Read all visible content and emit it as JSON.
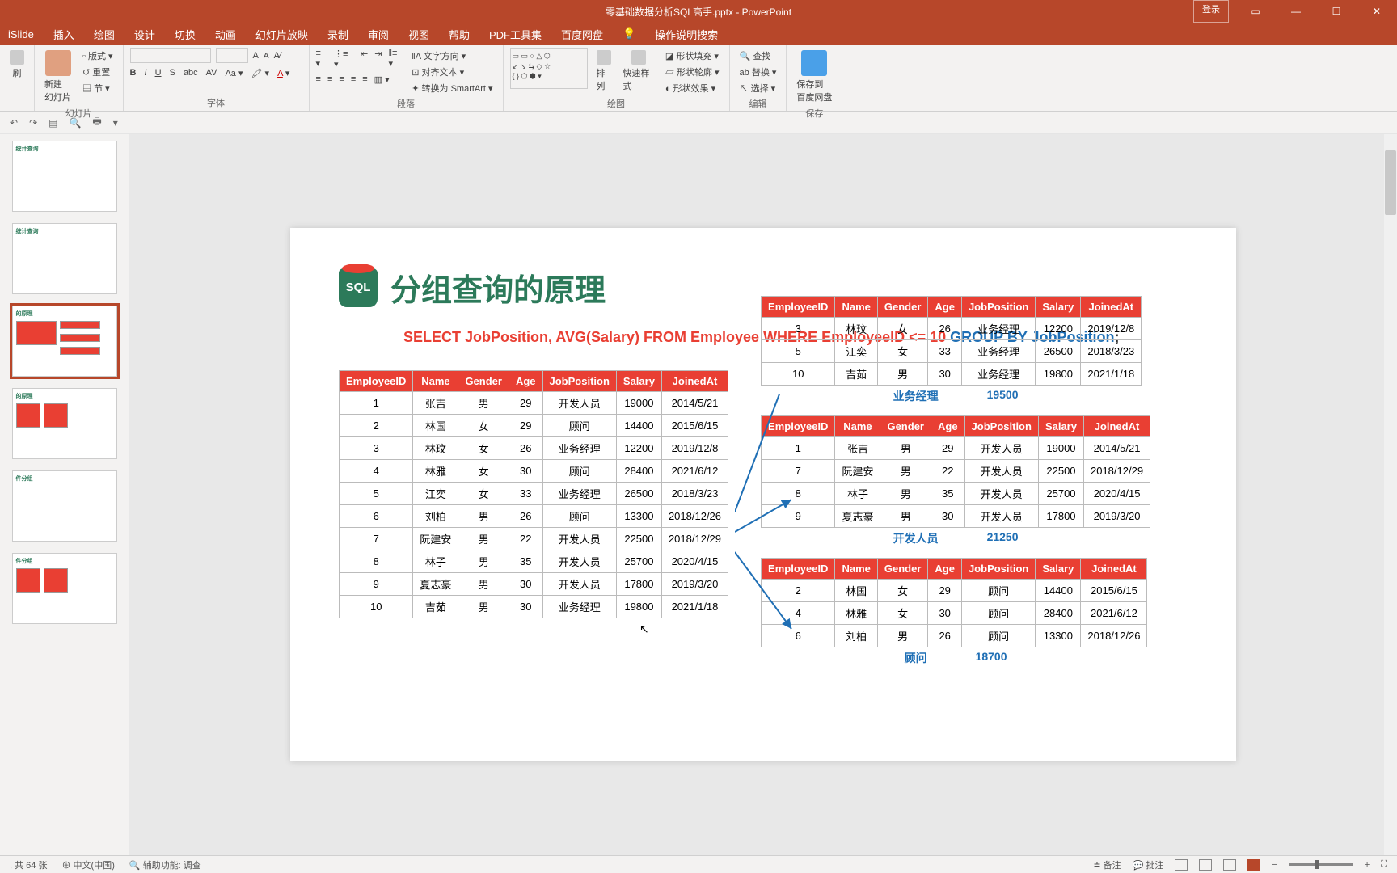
{
  "title_bar": {
    "filename": "零基础数据分析SQL高手.pptx  -  PowerPoint",
    "login": "登录"
  },
  "menu": [
    "iSlide",
    "插入",
    "绘图",
    "设计",
    "切换",
    "动画",
    "幻灯片放映",
    "录制",
    "审阅",
    "视图",
    "帮助",
    "PDF工具集",
    "百度网盘"
  ],
  "tell_me_icon": "💡",
  "tell_me": "操作说明搜索",
  "ribbon": {
    "g1_label": "幻灯片",
    "g1_new": "新建\n幻灯片",
    "g1_layout": "版式",
    "g1_reset": "重置",
    "g1_section": "节",
    "g2_label": "字体",
    "g3_label": "段落",
    "g3_dir": "文字方向",
    "g3_align": "对齐文本",
    "g3_smart": "转换为 SmartArt",
    "g4_label": "绘图",
    "g4_arrange": "排列",
    "g4_quick": "快速样式",
    "g4_fill": "形状填充",
    "g4_outline": "形状轮廓",
    "g4_fx": "形状效果",
    "g5_label": "编辑",
    "g5_find": "查找",
    "g5_replace": "替换",
    "g5_select": "选择",
    "g6_label": "保存",
    "g6_save": "保存到\n百度网盘"
  },
  "slide": {
    "title": "分组查询的原理",
    "sql_icon": "SQL",
    "query_red": "SELECT JobPosition, AVG(Salary) FROM Employee WHERE EmployeeID <= 10 ",
    "query_blue": "GROUP BY JobPosition",
    "query_end": ";",
    "headers": [
      "EmployeeID",
      "Name",
      "Gender",
      "Age",
      "JobPosition",
      "Salary",
      "JoinedAt"
    ],
    "main_rows": [
      [
        "1",
        "张吉",
        "男",
        "29",
        "开发人员",
        "19000",
        "2014/5/21"
      ],
      [
        "2",
        "林国",
        "女",
        "29",
        "顾问",
        "14400",
        "2015/6/15"
      ],
      [
        "3",
        "林玟",
        "女",
        "26",
        "业务经理",
        "12200",
        "2019/12/8"
      ],
      [
        "4",
        "林雅",
        "女",
        "30",
        "顾问",
        "28400",
        "2021/6/12"
      ],
      [
        "5",
        "江奕",
        "女",
        "33",
        "业务经理",
        "26500",
        "2018/3/23"
      ],
      [
        "6",
        "刘柏",
        "男",
        "26",
        "顾问",
        "13300",
        "2018/12/26"
      ],
      [
        "7",
        "阮建安",
        "男",
        "22",
        "开发人员",
        "22500",
        "2018/12/29"
      ],
      [
        "8",
        "林子",
        "男",
        "35",
        "开发人员",
        "25700",
        "2020/4/15"
      ],
      [
        "9",
        "夏志豪",
        "男",
        "30",
        "开发人员",
        "17800",
        "2019/3/20"
      ],
      [
        "10",
        "吉茹",
        "男",
        "30",
        "业务经理",
        "19800",
        "2021/1/18"
      ]
    ],
    "group1": {
      "rows": [
        [
          "3",
          "林玟",
          "女",
          "26",
          "业务经理",
          "12200",
          "2019/12/8"
        ],
        [
          "5",
          "江奕",
          "女",
          "33",
          "业务经理",
          "26500",
          "2018/3/23"
        ],
        [
          "10",
          "吉茹",
          "男",
          "30",
          "业务经理",
          "19800",
          "2021/1/18"
        ]
      ],
      "sum_label": "业务经理",
      "sum_val": "19500"
    },
    "group2": {
      "rows": [
        [
          "1",
          "张吉",
          "男",
          "29",
          "开发人员",
          "19000",
          "2014/5/21"
        ],
        [
          "7",
          "阮建安",
          "男",
          "22",
          "开发人员",
          "22500",
          "2018/12/29"
        ],
        [
          "8",
          "林子",
          "男",
          "35",
          "开发人员",
          "25700",
          "2020/4/15"
        ],
        [
          "9",
          "夏志豪",
          "男",
          "30",
          "开发人员",
          "17800",
          "2019/3/20"
        ]
      ],
      "sum_label": "开发人员",
      "sum_val": "21250"
    },
    "group3": {
      "rows": [
        [
          "2",
          "林国",
          "女",
          "29",
          "顾问",
          "14400",
          "2015/6/15"
        ],
        [
          "4",
          "林雅",
          "女",
          "30",
          "顾问",
          "28400",
          "2021/6/12"
        ],
        [
          "6",
          "刘柏",
          "男",
          "26",
          "顾问",
          "13300",
          "2018/12/26"
        ]
      ],
      "sum_label": "顾问",
      "sum_val": "18700"
    }
  },
  "status": {
    "pages": ", 共 64 张",
    "lang": "中文(中国)",
    "a11y": "辅助功能: 调查",
    "notes": "备注",
    "comments": "批注"
  }
}
